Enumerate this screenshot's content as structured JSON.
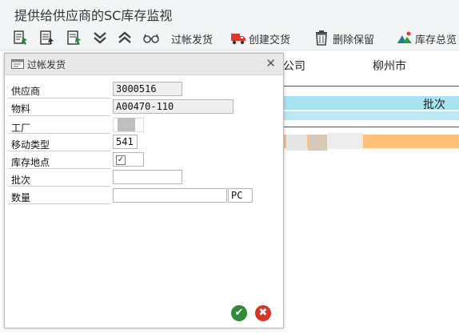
{
  "app": {
    "title": "提供给供应商的SC库存监视"
  },
  "toolbar": {
    "icons": [
      "select-doc-icon",
      "doc-list-icon",
      "doc-select-icon",
      "expand-all-icon",
      "collapse-all-icon",
      "glasses-icon"
    ],
    "post_issue_label": "过帐发货",
    "create_delivery_label": "创建交货",
    "delete_reservation_label": "删除保留",
    "stock_overview_label": "库存总览"
  },
  "background": {
    "company_text": "公司",
    "city_text": "柳州市",
    "batch_text": "批次"
  },
  "dialog": {
    "title": "过帐发货",
    "fields": {
      "vendor_label": "供应商",
      "vendor_value": "3000516",
      "material_label": "物料",
      "material_value": "A00470-110",
      "plant_label": "工厂",
      "plant_value": "",
      "movement_type_label": "移动类型",
      "movement_type_value": "541",
      "storage_location_label": "库存地点",
      "storage_location_checked": true,
      "batch_label": "批次",
      "batch_value": "",
      "quantity_label": "数量",
      "quantity_value": "",
      "unit_value": "PC"
    }
  },
  "colors": {
    "accent_blue": "#a8e3f2",
    "accent_orange": "#ffc07a",
    "confirm_green": "#2d8b3a",
    "cancel_red": "#d6352b",
    "delivery_truck": "#d93a2b"
  }
}
